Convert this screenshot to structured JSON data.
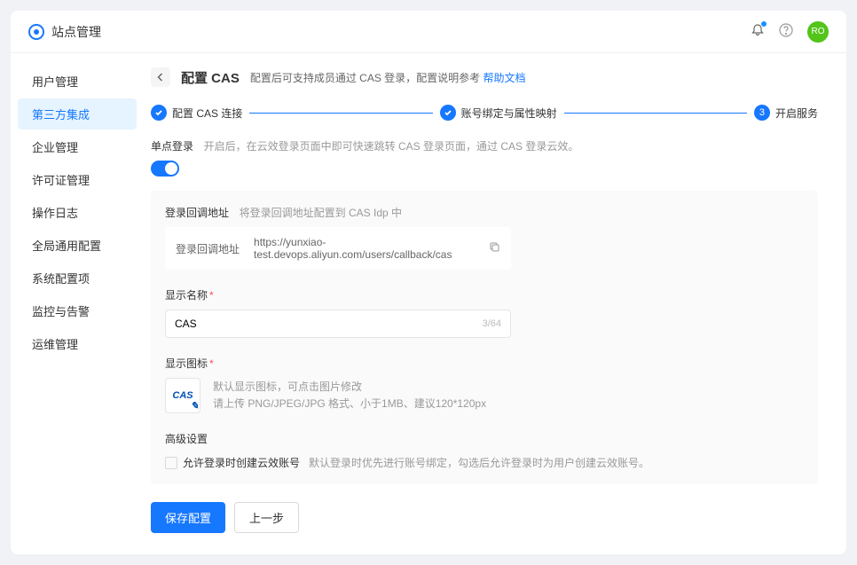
{
  "header": {
    "title": "站点管理",
    "avatar": "RO"
  },
  "sidebar": {
    "items": [
      {
        "label": "用户管理"
      },
      {
        "label": "第三方集成"
      },
      {
        "label": "企业管理"
      },
      {
        "label": "许可证管理"
      },
      {
        "label": "操作日志"
      },
      {
        "label": "全局通用配置"
      },
      {
        "label": "系统配置项"
      },
      {
        "label": "监控与告警"
      },
      {
        "label": "运维管理"
      }
    ]
  },
  "page": {
    "title": "配置 CAS",
    "subtitle": "配置后可支持成员通过 CAS 登录，配置说明参考 ",
    "help": "帮助文档"
  },
  "steps": {
    "s1": "配置 CAS 连接",
    "s2": "账号绑定与属性映射",
    "s3": "开启服务",
    "s3num": "3"
  },
  "sso": {
    "title": "单点登录",
    "desc": "开启后，在云效登录页面中即可快速跳转 CAS 登录页面，通过 CAS 登录云效。"
  },
  "callback": {
    "label": "登录回调地址",
    "desc": "将登录回调地址配置到 CAS Idp 中",
    "boxlabel": "登录回调地址",
    "url": "https://yunxiao-test.devops.aliyun.com/users/callback/cas"
  },
  "display": {
    "label": "显示名称",
    "value": "CAS",
    "counter": "3/64"
  },
  "icon": {
    "label": "显示图标",
    "preview": "CAS",
    "hint1": "默认显示图标，可点击图片修改",
    "hint2": "请上传 PNG/JPEG/JPG 格式、小于1MB、建议120*120px"
  },
  "adv": {
    "title": "高级设置",
    "chklabel": "允许登录时创建云效账号",
    "chkdesc": "默认登录时优先进行账号绑定，勾选后允许登录时为用户创建云效账号。"
  },
  "actions": {
    "save": "保存配置",
    "prev": "上一步"
  }
}
